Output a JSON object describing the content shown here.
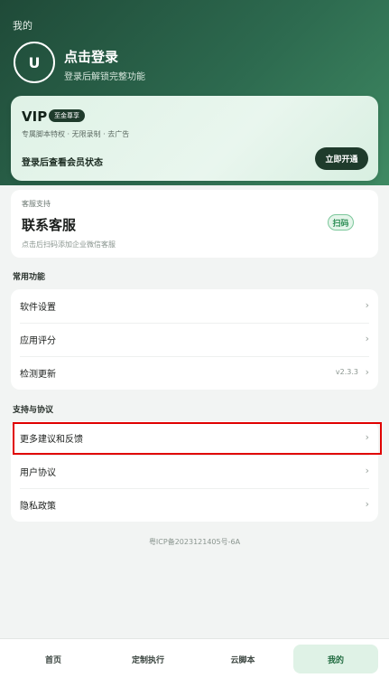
{
  "header": {
    "page_label": "我的",
    "avatar_letter": "U",
    "login_title": "点击登录",
    "login_subtitle": "登录后解锁完整功能"
  },
  "vip": {
    "title": "VIP",
    "badge": "至金尊享",
    "subtitle": "专属脚本特权 · 无限录制 · 去广告",
    "status": "登录后查看会员状态",
    "button": "立即开通"
  },
  "support": {
    "label": "客服支持",
    "title": "联系客服",
    "subtitle": "点击后扫码添加企业微信客服",
    "scan_button": "扫码"
  },
  "common": {
    "title": "常用功能",
    "items": [
      {
        "label": "软件设置",
        "value": "",
        "chevron": "›"
      },
      {
        "label": "应用评分",
        "value": "",
        "chevron": "›"
      },
      {
        "label": "检测更新",
        "value": "v2.3.3",
        "chevron": "›"
      }
    ]
  },
  "agreements": {
    "title": "支持与协议",
    "items": [
      {
        "label": "更多建议和反馈",
        "chevron": "›"
      },
      {
        "label": "用户协议",
        "chevron": "›"
      },
      {
        "label": "隐私政策",
        "chevron": "›"
      }
    ]
  },
  "footer": {
    "icp": "粤ICP备2023121405号-6A"
  },
  "tabs": [
    {
      "label": "首页"
    },
    {
      "label": "定制执行"
    },
    {
      "label": "云脚本"
    },
    {
      "label": "我的"
    }
  ],
  "colors": {
    "brand_dark": "#1f4a38",
    "accent_green": "#2f8f56",
    "highlight_red": "#e00000"
  }
}
